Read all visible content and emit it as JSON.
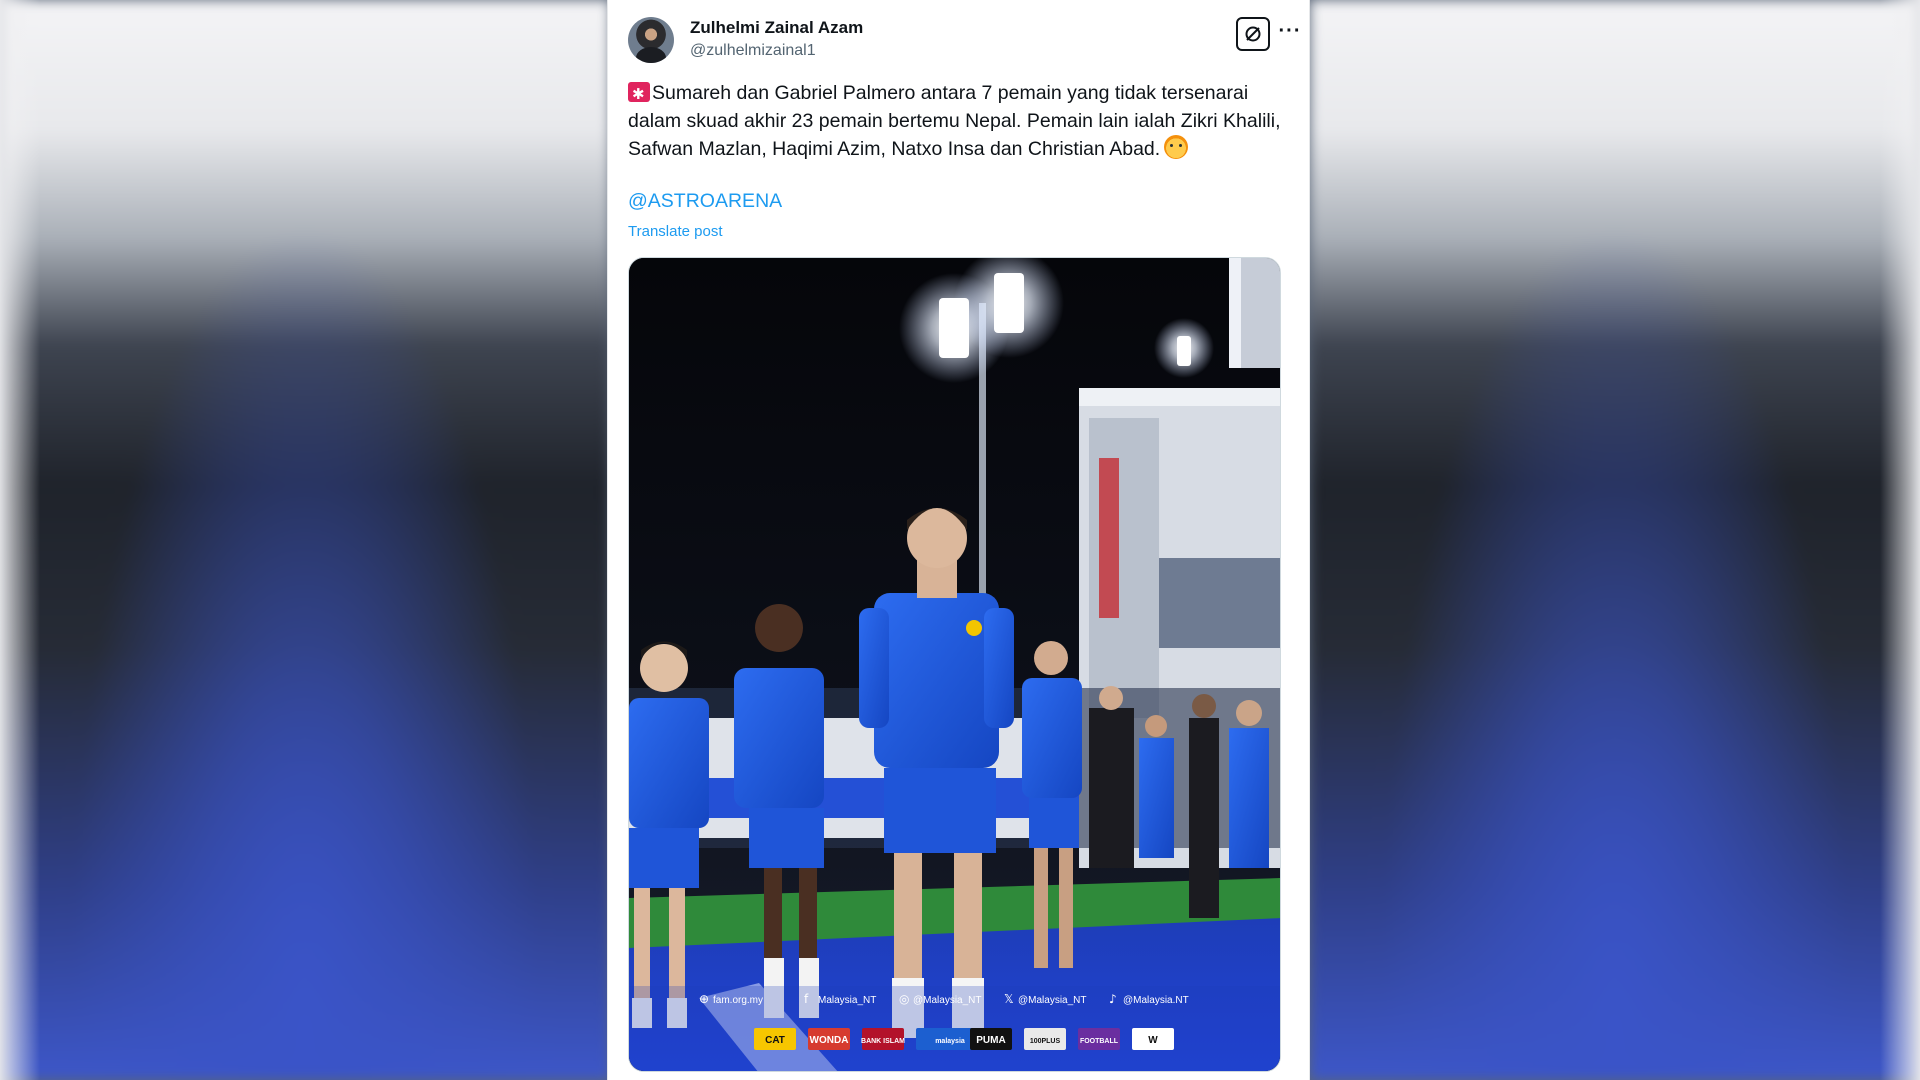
{
  "tweet": {
    "author_name": "Zulhelmi Zainal Azam",
    "author_handle": "@zulhelmizainal1",
    "text": "Sumareh dan Gabriel Palmero antara 7 pemain yang tidak tersenarai dalam skuad akhir 23 pemain bertemu Nepal. Pemain lain ialah Zikri Khalili, Safwan Mazlan, Haqimi Azim, Natxo Insa dan Christian Abad.",
    "mention": "@ASTROARENA",
    "translate_label": "Translate post",
    "more_label": "···"
  },
  "media": {
    "social_strip": {
      "website": "fam.org.my",
      "facebook": "Malaysia_NT",
      "instagram": "@Malaysia_NT",
      "x": "@Malaysia_NT",
      "tiktok": "@Malaysia.NT"
    },
    "sponsors": [
      "CAT",
      "WONDA",
      "BANK ISLAM",
      "malaysia",
      "PUMA",
      "100PLUS",
      "FOOTBALL",
      "W"
    ]
  },
  "colors": {
    "link": "#1d9bf0",
    "text": "#0f1419",
    "muted": "#536471",
    "jersey": "#1f5fe0"
  }
}
